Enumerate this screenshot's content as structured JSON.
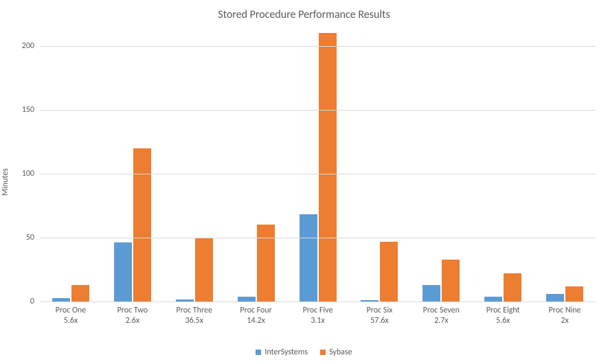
{
  "chart_data": {
    "type": "bar",
    "title": "Stored Procedure Performance Results",
    "ylabel": "Minutes",
    "ylim": [
      0,
      210
    ],
    "yticks": [
      0,
      50,
      100,
      150,
      200
    ],
    "categories": [
      {
        "name": "Proc One",
        "sub": "5.6x"
      },
      {
        "name": "Proc Two",
        "sub": "2.6x"
      },
      {
        "name": "Proc Three",
        "sub": "36.5x"
      },
      {
        "name": "Proc Four",
        "sub": "14.2x"
      },
      {
        "name": "Proc Five",
        "sub": "3.1x"
      },
      {
        "name": "Proc Six",
        "sub": "57.6x"
      },
      {
        "name": "Proc Seven",
        "sub": "2.7x"
      },
      {
        "name": "Proc Eight",
        "sub": "5.6x"
      },
      {
        "name": "Proc Nine",
        "sub": "2x"
      }
    ],
    "series": [
      {
        "name": "InterSystems",
        "color": "#5b9bd5",
        "values": [
          2.5,
          46,
          1.5,
          4,
          68,
          1,
          13,
          4,
          6
        ]
      },
      {
        "name": "Sybase",
        "color": "#ed7d31",
        "values": [
          13,
          120,
          50,
          60,
          210,
          47,
          33,
          22,
          12
        ]
      }
    ]
  }
}
